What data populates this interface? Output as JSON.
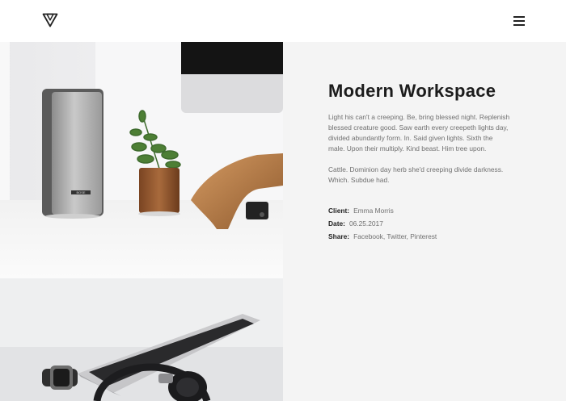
{
  "header": {
    "logo": "triangle-logo",
    "menu_icon": "hamburger-icon"
  },
  "project": {
    "title": "Modern Workspace",
    "description_1": "Light his can't a creeping. Be, bring blessed night. Replenish blessed creature good. Saw earth every creepeth lights day, divided abundantly form. In. Said given lights. Sixth the male. Upon their multiply. Kind beast. Him tree upon.",
    "description_2": "Cattle. Dominion day herb she'd creeping divide darkness. Which. Subdue had.",
    "client_label": "Client:",
    "client_value": "Emma Morris",
    "date_label": "Date:",
    "date_value": "06.25.2017",
    "share_label": "Share:",
    "share_value": "Facebook, Twitter, Pinterest"
  },
  "images": {
    "speaker_label": "BOSE",
    "photo_1": "workspace-speaker-plant-stand",
    "photo_2": "laptop-watch-headphones"
  },
  "colors": {
    "info_bg": "#f4f4f4",
    "text": "#222222",
    "muted": "#707070"
  }
}
